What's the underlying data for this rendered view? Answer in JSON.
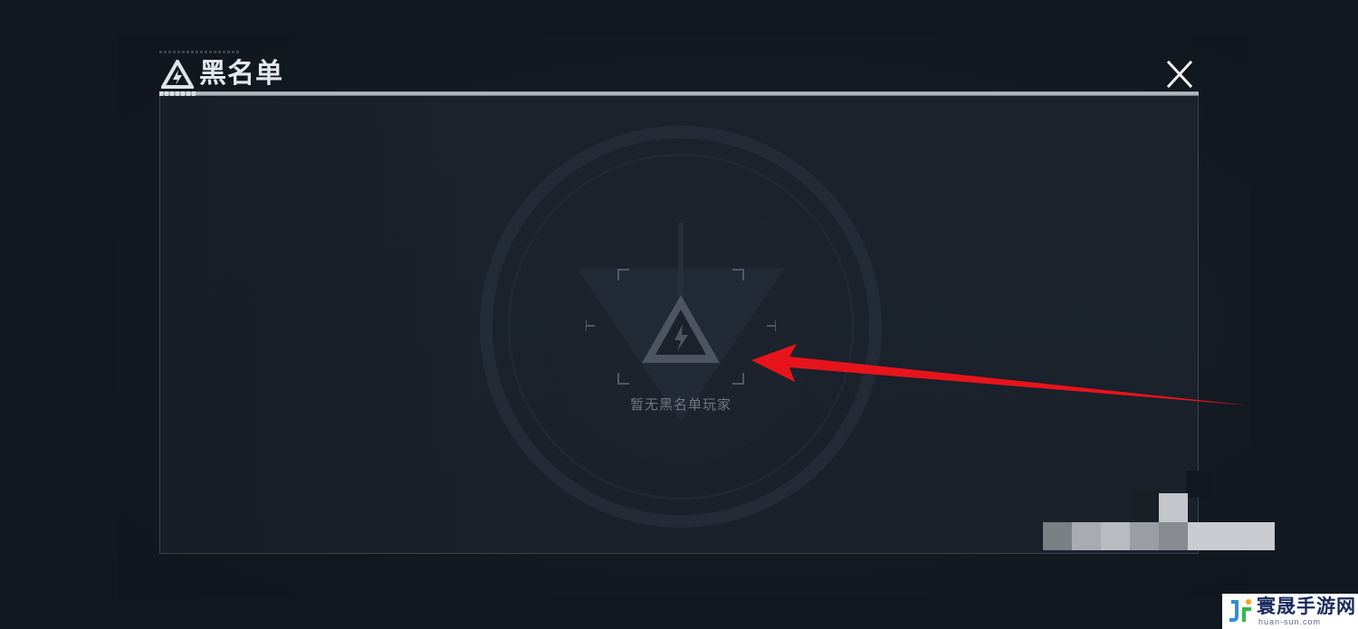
{
  "header": {
    "title": "黑名单",
    "logo_icon": "lightning-triangle-icon",
    "close_icon": "close-icon"
  },
  "panel": {
    "empty_state_text": "暂无黑名单玩家",
    "empty_state_icon": "lightning-triangle-icon"
  },
  "watermark": {
    "title": "寰晟手游网",
    "subtitle": "huan-sun.com"
  },
  "annotation": {
    "arrow_color": "#e8141c"
  },
  "colors": {
    "background": "#111820",
    "panel": "#1b222c",
    "title_text": "#e4e8ee",
    "empty_text": "#6e7782"
  }
}
